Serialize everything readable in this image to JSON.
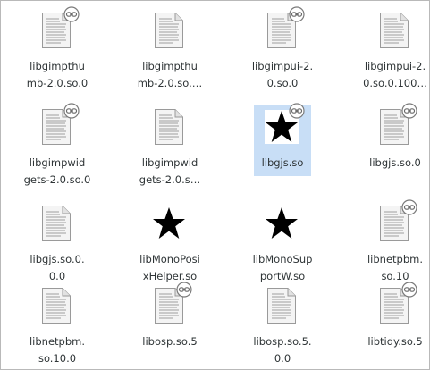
{
  "files": [
    {
      "name": "libgimpthumb-2.0.so.0",
      "label_lines": [
        "libgimpthu",
        "mb-2.0.so.0"
      ],
      "icon": "text-document-icon",
      "symlink": true,
      "selected": false
    },
    {
      "name": "libgimpthumb-2.0.so.…",
      "label_lines": [
        "libgimpthu",
        "mb-2.0.so.…"
      ],
      "icon": "text-document-icon",
      "symlink": false,
      "selected": false
    },
    {
      "name": "libgimpui-2.0.so.0",
      "label_lines": [
        "libgimpui-2.",
        "0.so.0"
      ],
      "icon": "text-document-icon",
      "symlink": true,
      "selected": false
    },
    {
      "name": "libgimpui-2.0.so.0.100…",
      "label_lines": [
        "libgimpui-2.",
        "0.so.0.100…"
      ],
      "icon": "text-document-icon",
      "symlink": false,
      "selected": false
    },
    {
      "name": "libgimpwidgets-2.0.so.0",
      "label_lines": [
        "libgimpwid",
        "gets-2.0.so.0"
      ],
      "icon": "text-document-icon",
      "symlink": true,
      "selected": false
    },
    {
      "name": "libgimpwidgets-2.0.s…",
      "label_lines": [
        "libgimpwid",
        "gets-2.0.s…"
      ],
      "icon": "text-document-icon",
      "symlink": false,
      "selected": false
    },
    {
      "name": "libgjs.so",
      "label_lines": [
        "libgjs.so"
      ],
      "icon": "star-icon",
      "symlink": true,
      "selected": true
    },
    {
      "name": "libgjs.so.0",
      "label_lines": [
        "libgjs.so.0"
      ],
      "icon": "text-document-icon",
      "symlink": true,
      "selected": false
    },
    {
      "name": "libgjs.so.0.0.0",
      "label_lines": [
        "libgjs.so.0.",
        "0.0"
      ],
      "icon": "text-document-icon",
      "symlink": false,
      "selected": false
    },
    {
      "name": "libMonoPosixHelper.so",
      "label_lines": [
        "libMonoPosi",
        "xHelper.so"
      ],
      "icon": "star-icon",
      "symlink": false,
      "selected": false
    },
    {
      "name": "libMonoSupportW.so",
      "label_lines": [
        "libMonoSup",
        "portW.so"
      ],
      "icon": "star-icon",
      "symlink": false,
      "selected": false
    },
    {
      "name": "libnetpbm.so.10",
      "label_lines": [
        "libnetpbm.",
        "so.10"
      ],
      "icon": "text-document-icon",
      "symlink": true,
      "selected": false
    },
    {
      "name": "libnetpbm.so.10.0",
      "label_lines": [
        "libnetpbm.",
        "so.10.0"
      ],
      "icon": "text-document-icon",
      "symlink": false,
      "selected": false
    },
    {
      "name": "libosp.so.5",
      "label_lines": [
        "libosp.so.5"
      ],
      "icon": "text-document-icon",
      "symlink": true,
      "selected": false
    },
    {
      "name": "libosp.so.5.0.0",
      "label_lines": [
        "libosp.so.5.",
        "0.0"
      ],
      "icon": "text-document-icon",
      "symlink": false,
      "selected": false
    },
    {
      "name": "libtidy.so.5",
      "label_lines": [
        "libtidy.so.5"
      ],
      "icon": "text-document-icon",
      "symlink": true,
      "selected": false
    }
  ],
  "colors": {
    "selection": "#c8def6",
    "label_text": "#2e3436"
  }
}
